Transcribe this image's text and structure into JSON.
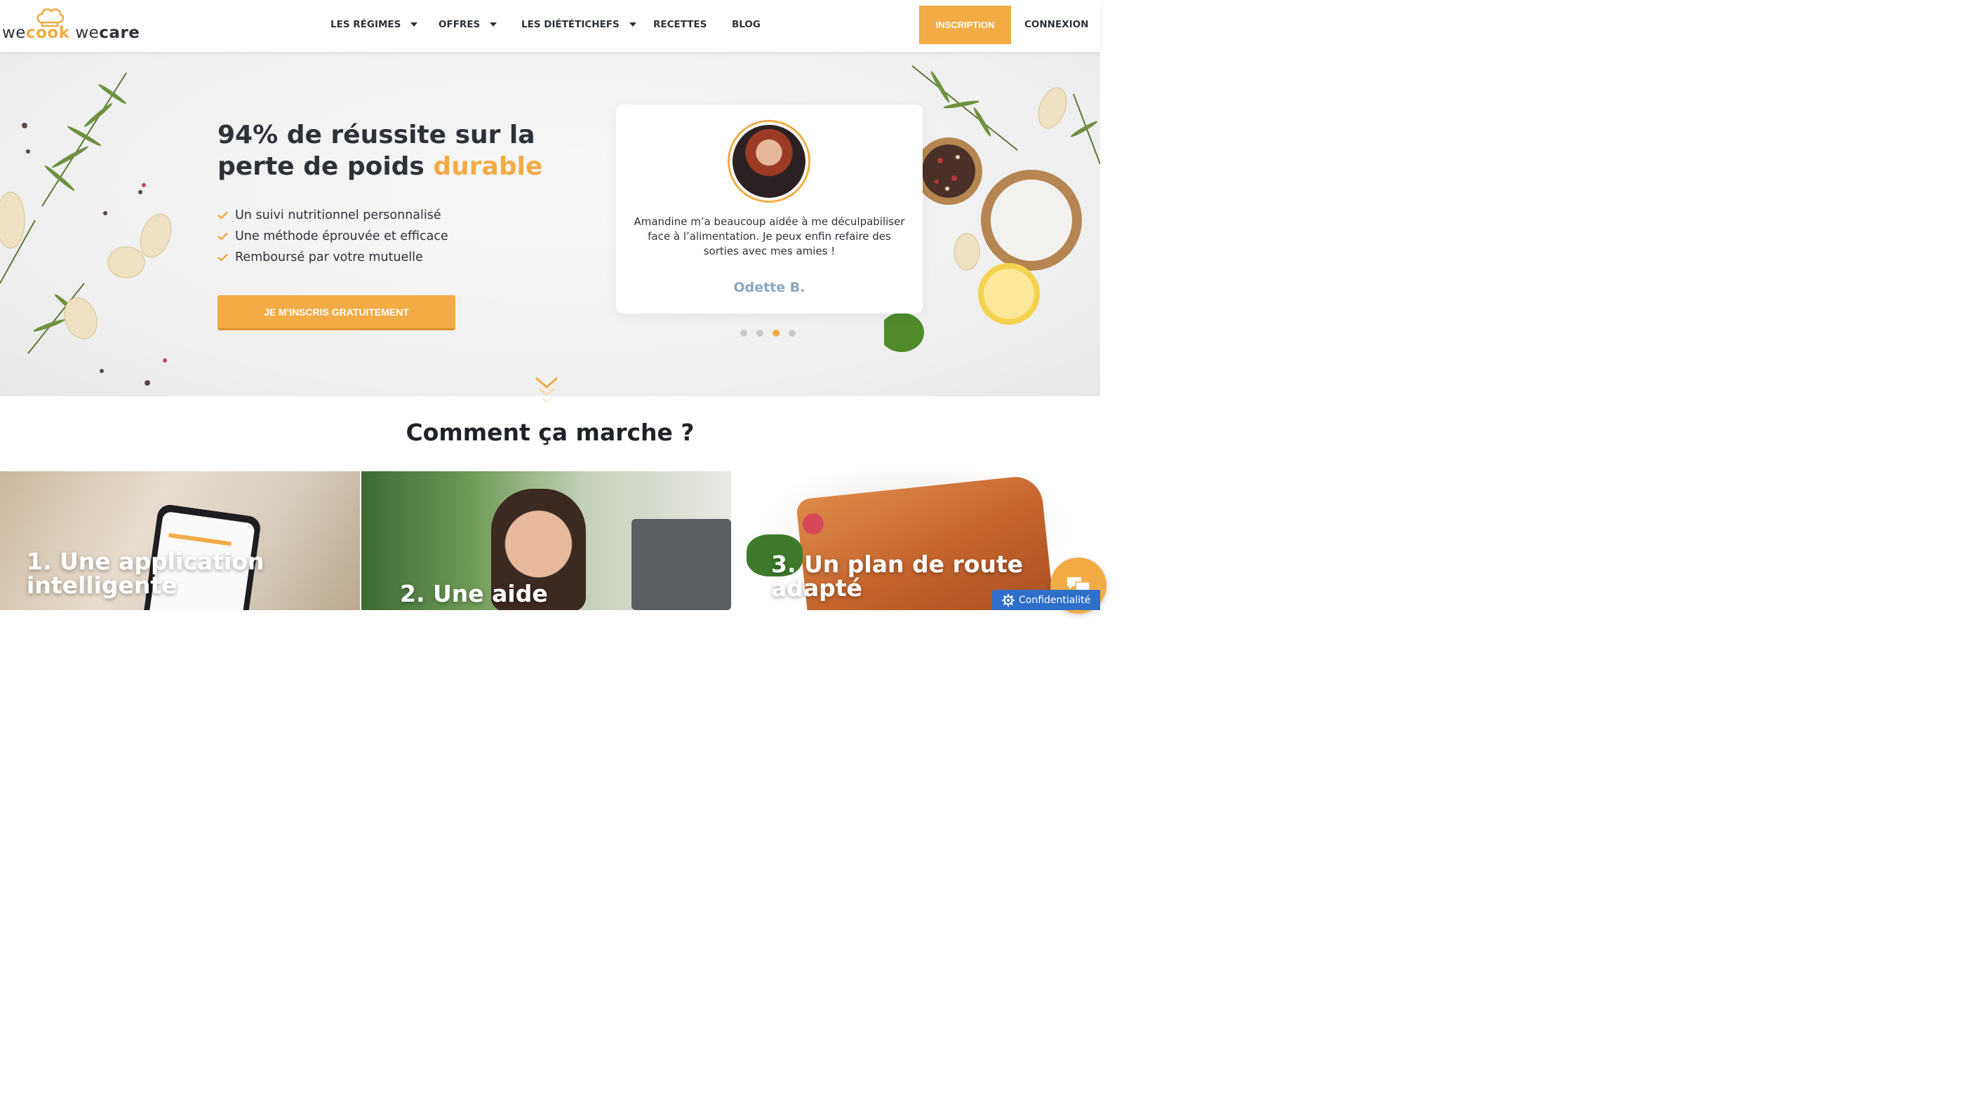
{
  "logo": {
    "we1": "we",
    "cook": "cook",
    "we2": "we",
    "care": "care"
  },
  "nav": {
    "items": [
      {
        "label": "LES RÉGIMES",
        "has_dropdown": true
      },
      {
        "label": "OFFRES",
        "has_dropdown": true
      },
      {
        "label": "LES DIÉTÉTICHEFS",
        "has_dropdown": true
      },
      {
        "label": "RECETTES",
        "has_dropdown": false
      },
      {
        "label": "BLOG",
        "has_dropdown": false
      }
    ],
    "inscription": "INSCRIPTION",
    "connexion": "CONNEXION"
  },
  "hero": {
    "title_part1": "94% de réussite sur la perte de poids",
    "title_accent": "durable",
    "bullets": [
      "Un suivi nutritionnel personnalisé",
      "Une méthode éprouvée et efficace",
      "Remboursé par votre mutuelle"
    ],
    "cta": "JE M'INSCRIS GRATUITEMENT"
  },
  "testimonial": {
    "quote": "Amandine m’a beaucoup aidée à me déculpabiliser face à l’alimentation. Je peux enfin refaire des sorties avec mes amies !",
    "author": "Odette B.",
    "slides_total": 4,
    "active_slide": 3
  },
  "how": {
    "title": "Comment ça marche ?",
    "cards": [
      {
        "title": "1. Une application intelligente"
      },
      {
        "title": "2. Une aide"
      },
      {
        "title": "3. Un plan de route adapté"
      }
    ]
  },
  "widgets": {
    "privacy_label": "Confidentialité"
  },
  "colors": {
    "accent": "#f2ab45",
    "dark_text": "#2d3138",
    "author": "#8aa7c0",
    "privacy_bg": "#2f6fc9"
  },
  "icons": [
    "chef-hat-icon",
    "chevron-down-icon",
    "check-icon",
    "double-chevron-down-icon",
    "chat-icon",
    "gear-icon"
  ]
}
